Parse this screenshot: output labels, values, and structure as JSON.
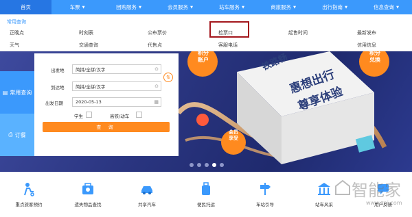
{
  "nav": [
    {
      "label": "首页",
      "caret": false
    },
    {
      "label": "车票",
      "caret": true
    },
    {
      "label": "团购服务",
      "caret": true
    },
    {
      "label": "会员服务",
      "caret": true
    },
    {
      "label": "站车服务",
      "caret": true
    },
    {
      "label": "商旅服务",
      "caret": true
    },
    {
      "label": "出行指南",
      "caret": true
    },
    {
      "label": "信息查询",
      "caret": true
    }
  ],
  "dropdown": {
    "title": "常用查询",
    "items": [
      "正晚点",
      "时刻表",
      "公布票价",
      "检票口",
      "起售时间",
      "最新发布",
      "天气",
      "交通查询",
      "代售点",
      "客服电话",
      "信用信息"
    ]
  },
  "side_tabs": {
    "query": "常用查询",
    "order": "订餐"
  },
  "form": {
    "from_label": "出发地",
    "from_placeholder": "简拼/全拼/汉字",
    "to_label": "到达地",
    "to_placeholder": "简拼/全拼/汉字",
    "date_label": "出发日期",
    "date_value": "2020-05-13",
    "student_label": "学生",
    "gaotie_label": "高铁/动车",
    "query_button": "查 询"
  },
  "banner": {
    "line1": "惠想出行",
    "line2": "尊享体验",
    "box_label": "铁路畅",
    "badge_left": "积分\n账户",
    "badge_right": "积分\n兑换",
    "badge_member": "会员\n享受",
    "slides_total": 5,
    "slide_active": 4
  },
  "services": [
    {
      "label": "重点旅客预约",
      "icon": "passenger-icon"
    },
    {
      "label": "遗失物品查找",
      "icon": "lost-item-icon"
    },
    {
      "label": "共享汽车",
      "icon": "car-icon"
    },
    {
      "label": "便民托运",
      "icon": "luggage-icon"
    },
    {
      "label": "车站引导",
      "icon": "signpost-icon"
    },
    {
      "label": "站车风采",
      "icon": "station-icon"
    },
    {
      "label": "用户反馈",
      "icon": "feedback-icon"
    }
  ],
  "watermark": {
    "text": "智能家",
    "url": "www.znj.com"
  },
  "colors": {
    "nav": "#3b99fc",
    "nav_active": "#2676e3",
    "accent": "#ff8a1f",
    "highlight": "#a3161c"
  }
}
